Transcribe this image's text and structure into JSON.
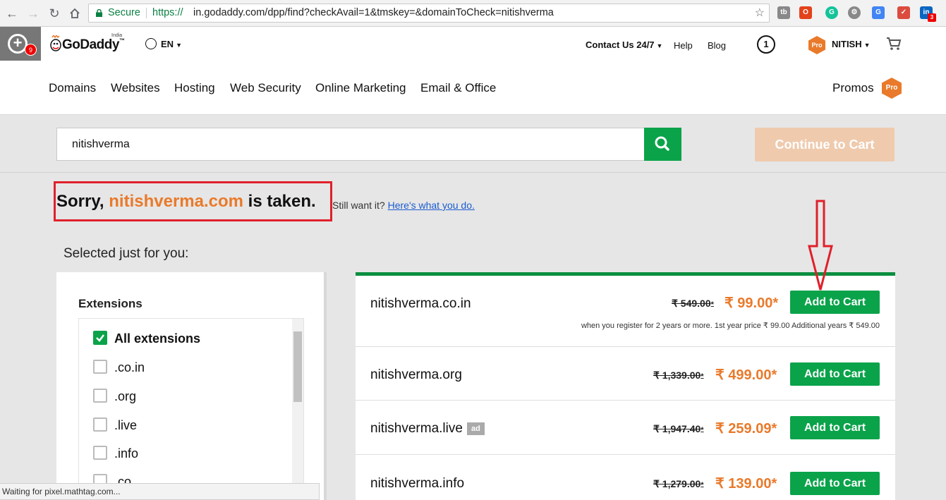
{
  "browser": {
    "secure_label": "Secure",
    "url_scheme": "https://",
    "url_rest": "in.godaddy.com/dpp/find?checkAvail=1&tmskey=&domainToCheck=nitishverma",
    "ext_icons": [
      "tb-icon",
      "office-icon",
      "grammarly-icon",
      "settings-gear-icon",
      "translate-icon",
      "todo-icon",
      "linkedin-icon"
    ],
    "linkedin_badge": "3"
  },
  "header": {
    "ext_badge": "9",
    "logo_text": "GoDaddy",
    "logo_region": "India",
    "language": "EN",
    "contact": "Contact Us 24/7",
    "help": "Help",
    "blog": "Blog",
    "notification_count": "1",
    "pro_badge": "Pro",
    "user_name": "NITISH"
  },
  "nav": {
    "items": [
      "Domains",
      "Websites",
      "Hosting",
      "Web Security",
      "Online Marketing",
      "Email & Office"
    ],
    "promos": "Promos",
    "promos_badge": "Pro"
  },
  "search": {
    "value": "nitishverma",
    "continue_label": "Continue to Cart"
  },
  "result_header": {
    "sorry": "Sorry, ",
    "domain": "nitishverma.com",
    "taken": " is taken.",
    "still_text": "Still want it? ",
    "still_link": "Here's what you do."
  },
  "selected_title": "Selected just for you:",
  "extensions": {
    "title": "Extensions",
    "items": [
      {
        "label": "All extensions",
        "checked": true
      },
      {
        "label": ".co.in",
        "checked": false
      },
      {
        "label": ".org",
        "checked": false
      },
      {
        "label": ".live",
        "checked": false
      },
      {
        "label": ".info",
        "checked": false
      },
      {
        "label": ".co",
        "checked": false
      }
    ]
  },
  "results": [
    {
      "sld": "nitishverma",
      "tld": ".co.in",
      "old_price": "₹ 549.00",
      "new_price": "₹ 99.00*",
      "button": "Add to Cart",
      "ad": "",
      "note": "when you register for 2 years or more. 1st year price ₹ 99.00 Additional years ₹ 549.00"
    },
    {
      "sld": "nitishverma",
      "tld": ".org",
      "old_price": "₹ 1,339.00",
      "new_price": "₹ 499.00*",
      "button": "Add to Cart",
      "ad": "",
      "note": ""
    },
    {
      "sld": "nitishverma",
      "tld": ".live",
      "old_price": "₹ 1,947.40",
      "new_price": "₹ 259.09*",
      "button": "Add to Cart",
      "ad": "ad",
      "note": ""
    },
    {
      "sld": "nitishverma",
      "tld": ".info",
      "old_price": "₹ 1,279.00",
      "new_price": "₹ 139.00*",
      "button": "Add to Cart",
      "ad": "",
      "note": ""
    }
  ],
  "status_bar": "Waiting for pixel.mathtag.com...",
  "colors": {
    "accent_green": "#0aa34a",
    "brand_orange": "#e97a2b",
    "annotation_red": "#e0202b"
  }
}
